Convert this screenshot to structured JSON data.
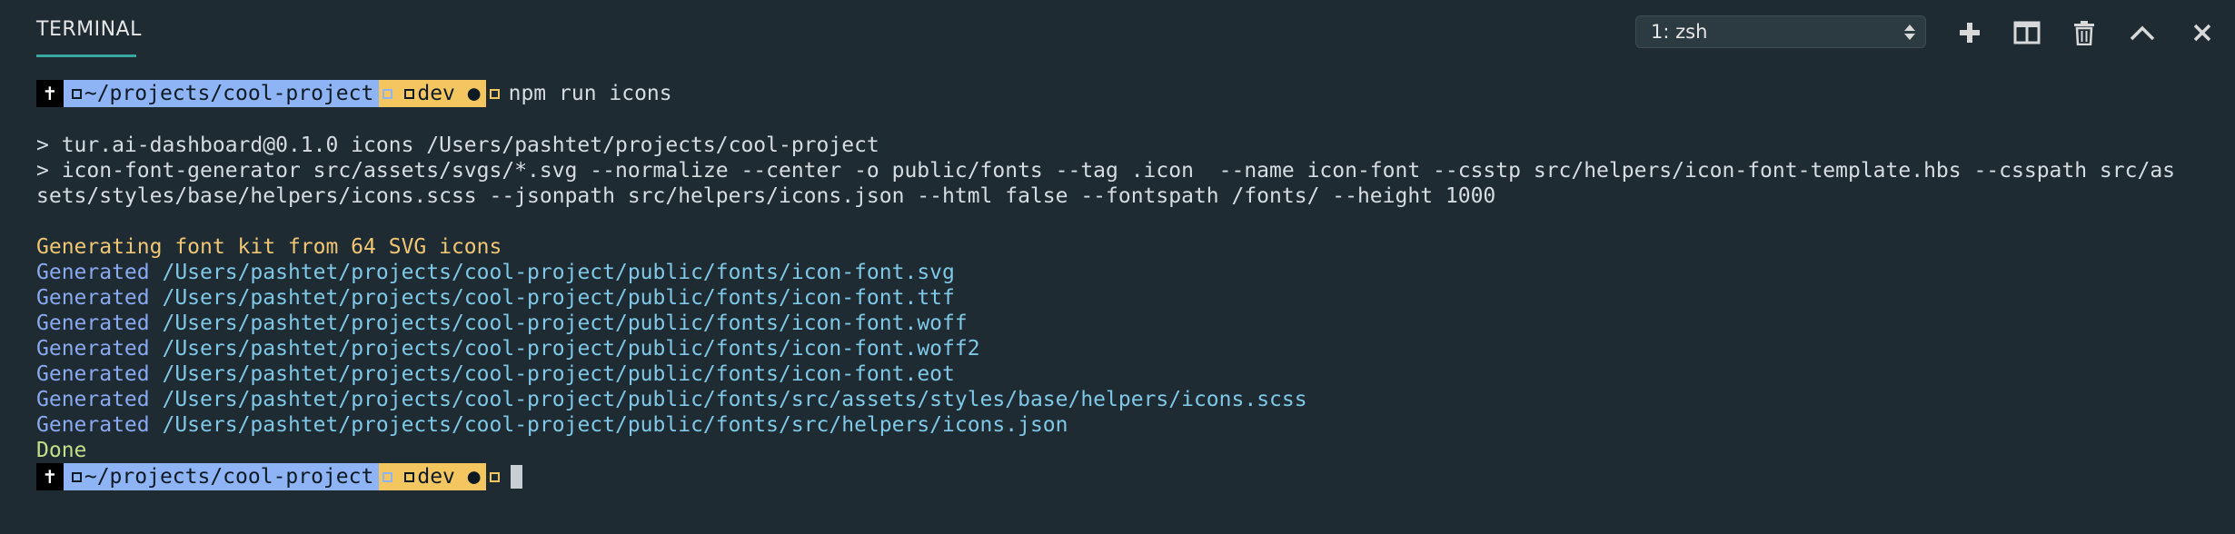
{
  "header": {
    "tab_label": "TERMINAL",
    "shell_select": "1: zsh"
  },
  "icons": {
    "new_terminal": "plus-icon",
    "split": "split-icon",
    "kill": "trash-icon",
    "maximize": "chevron-up-icon",
    "close": "close-icon"
  },
  "colors": {
    "background": "#1e2b33",
    "accent_underline": "#39a6a0",
    "prompt_path_bg": "#8fb4f5",
    "prompt_branch_bg": "#f3c660",
    "generating_text": "#f0c674",
    "generated_label": "#8aa9f0",
    "generated_path": "#7fc8e6",
    "done_text": "#c2e08a"
  },
  "prompt1": {
    "cross": "✝",
    "path": "~/projects/cool-project",
    "branch": "dev ●",
    "command": "npm run icons"
  },
  "output": {
    "script_line": "> tur.ai-dashboard@0.1.0 icons /Users/pashtet/projects/cool-project",
    "cmd_line_1": "> icon-font-generator src/assets/svgs/*.svg --normalize --center -o public/fonts --tag .icon  --name icon-font --csstp src/helpers/icon-font-template.hbs --csspath src/as",
    "cmd_line_2": "sets/styles/base/helpers/icons.scss --jsonpath src/helpers/icons.json --html false --fontspath /fonts/ --height 1000",
    "generating": "Generating font kit from 64 SVG icons",
    "generated_label": "Generated",
    "generated": [
      "/Users/pashtet/projects/cool-project/public/fonts/icon-font.svg",
      "/Users/pashtet/projects/cool-project/public/fonts/icon-font.ttf",
      "/Users/pashtet/projects/cool-project/public/fonts/icon-font.woff",
      "/Users/pashtet/projects/cool-project/public/fonts/icon-font.woff2",
      "/Users/pashtet/projects/cool-project/public/fonts/icon-font.eot",
      "/Users/pashtet/projects/cool-project/public/fonts/src/assets/styles/base/helpers/icons.scss",
      "/Users/pashtet/projects/cool-project/public/fonts/src/helpers/icons.json"
    ],
    "done": "Done"
  },
  "prompt2": {
    "cross": "✝",
    "path": "~/projects/cool-project",
    "branch": "dev ●"
  }
}
